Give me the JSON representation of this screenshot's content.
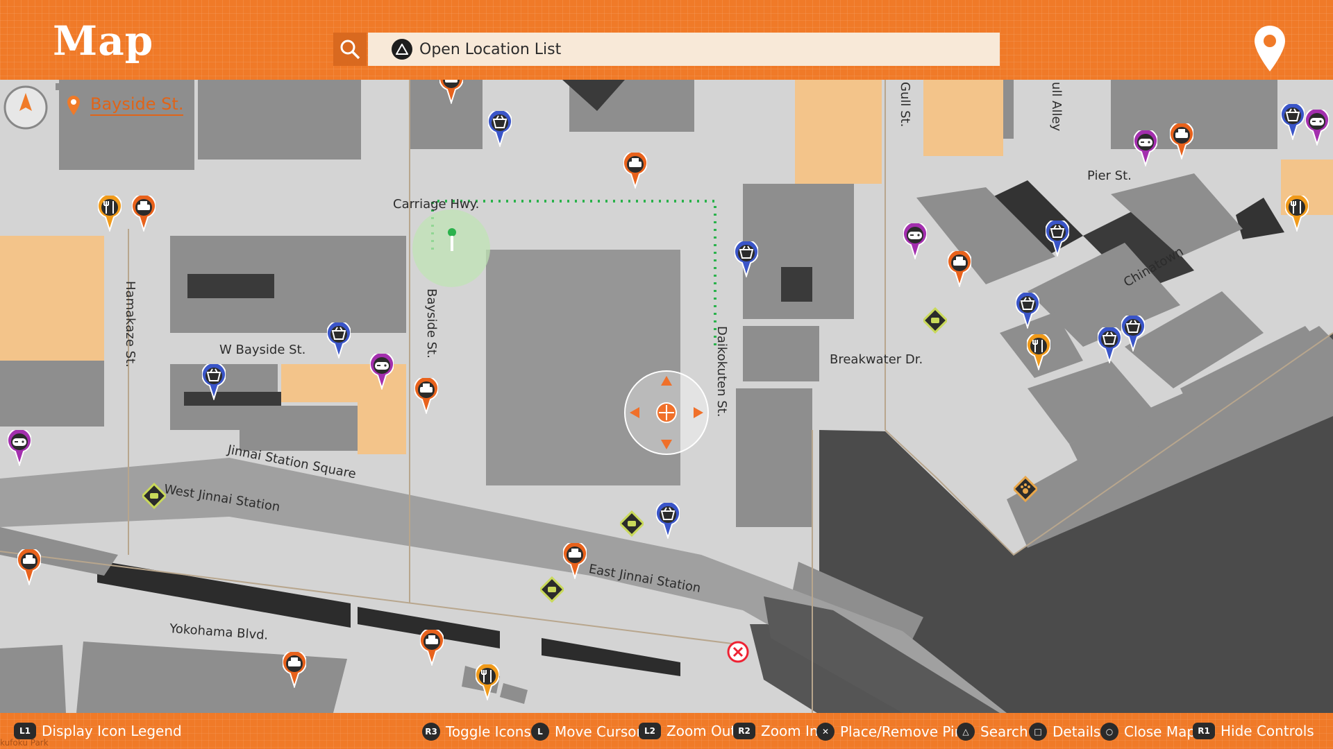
{
  "header": {
    "title": "Map",
    "search_placeholder": "Open Location List",
    "current_location": "Bayside St."
  },
  "streets": {
    "carriage_hwy": "Carriage Hwy.",
    "hamakaze_st": "Hamakaze St.",
    "bayside_st_vertical": "Bayside St.",
    "w_bayside_st": "W Bayside St.",
    "jinnai_station_square": "Jinnai Station Square",
    "west_jinnai_station": "West Jinnai Station",
    "daikokuten_st": "Daikokuten St.",
    "breakwater_dr": "Breakwater Dr.",
    "pier_st": "Pier St.",
    "chinatown": "Chinatown",
    "gull_st": "Gull St.",
    "gull_alley": "ull Alley",
    "east_jinnai_station": "East Jinnai Station",
    "yokohama_blvd": "Yokohama Blvd.",
    "kufoku_park": "kufoku Park"
  },
  "controls": [
    {
      "button": "L1",
      "label": "Display Icon Legend"
    },
    {
      "button": "R3",
      "label": "Toggle Icons"
    },
    {
      "button": "L",
      "label": "Move Cursor"
    },
    {
      "button": "L2",
      "label": "Zoom Out"
    },
    {
      "button": "R2",
      "label": "Zoom In"
    },
    {
      "button": "✕",
      "label": "Place/Remove Pin"
    },
    {
      "button": "△",
      "label": "Search"
    },
    {
      "button": "□",
      "label": "Details"
    },
    {
      "button": "○",
      "label": "Close Map"
    },
    {
      "button": "R1",
      "label": "Hide Controls"
    }
  ],
  "colors": {
    "accent_orange": "#f07a28",
    "taxi_pin": "#e8621c",
    "shop_pin": "#3a55c8",
    "game_pin": "#a32fae",
    "food_pin": "#f09a1a",
    "route_dots": "#2bb24c",
    "water": "#4a4a4a",
    "highlight_building": "#f3c48a"
  },
  "icons": {
    "search": "search-icon",
    "taxi": "taxi-icon",
    "shop": "shop-basket-icon",
    "game": "gamepad-icon",
    "food": "fork-knife-icon",
    "chat": "speech-bubble-icon",
    "paw": "paw-icon",
    "pin": "map-pin-icon",
    "cursor": "crosshair-icon",
    "remove": "close-circle-icon"
  }
}
